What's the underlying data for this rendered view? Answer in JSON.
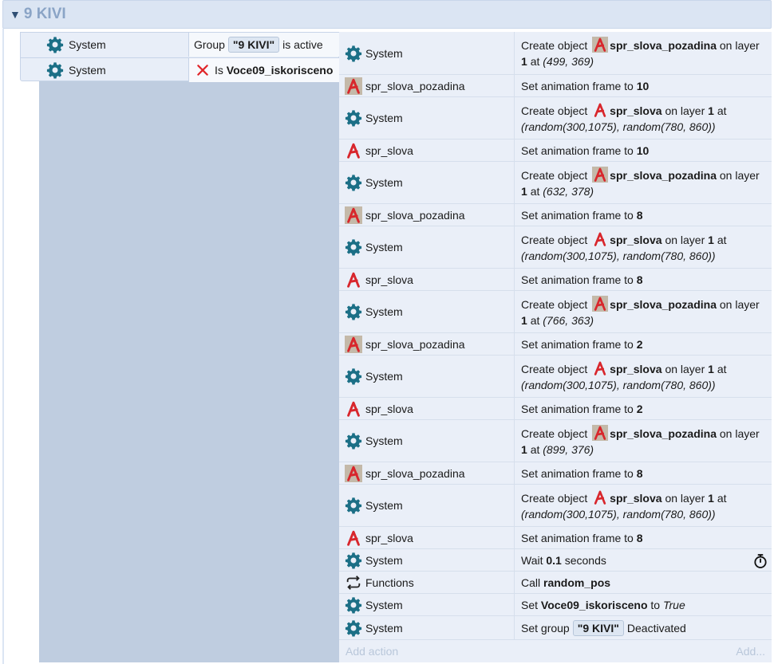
{
  "group": {
    "title": "9 KIVI",
    "collapse_icon": "triangle-down-icon"
  },
  "conditions": [
    {
      "object": "System",
      "icon": "gear-icon",
      "text_before": "Group",
      "chip": "\"9 KIVI\"",
      "text_after": "is active"
    },
    {
      "object": "System",
      "icon": "gear-icon",
      "inverted_icon": "red-x-icon",
      "text_before": "Is",
      "bold": "Voce09_iskorisceno"
    }
  ],
  "actions": [
    {
      "object": "System",
      "icon": "gear-icon",
      "line1_pre": "Create object",
      "line1_obj": "spr_slova_pozadina",
      "line1_post": "on layer",
      "layer": "1",
      "at": "at",
      "coords": "(499, 369)"
    },
    {
      "object": "spr_slova_pozadina",
      "icon": "sprite-a-bg-icon",
      "text": "Set animation frame to",
      "value": "10"
    },
    {
      "object": "System",
      "icon": "gear-icon",
      "line1_pre": "Create object",
      "line1_obj": "spr_slova",
      "line1_post": "on layer",
      "layer": "1",
      "at": "at",
      "coords": "(random(300,1075), random(780, 860))"
    },
    {
      "object": "spr_slova",
      "icon": "sprite-a-icon",
      "text": "Set animation frame to",
      "value": "10"
    },
    {
      "object": "System",
      "icon": "gear-icon",
      "line1_pre": "Create object",
      "line1_obj": "spr_slova_pozadina",
      "line1_post": "on layer",
      "layer": "1",
      "at": "at",
      "coords": "(632, 378)"
    },
    {
      "object": "spr_slova_pozadina",
      "icon": "sprite-a-bg-icon",
      "text": "Set animation frame to",
      "value": "8"
    },
    {
      "object": "System",
      "icon": "gear-icon",
      "line1_pre": "Create object",
      "line1_obj": "spr_slova",
      "line1_post": "on layer",
      "layer": "1",
      "at": "at",
      "coords": "(random(300,1075), random(780, 860))"
    },
    {
      "object": "spr_slova",
      "icon": "sprite-a-icon",
      "text": "Set animation frame to",
      "value": "8"
    },
    {
      "object": "System",
      "icon": "gear-icon",
      "line1_pre": "Create object",
      "line1_obj": "spr_slova_pozadina",
      "line1_post": "on layer",
      "layer": "1",
      "at": "at",
      "coords": "(766, 363)"
    },
    {
      "object": "spr_slova_pozadina",
      "icon": "sprite-a-bg-icon",
      "text": "Set animation frame to",
      "value": "2"
    },
    {
      "object": "System",
      "icon": "gear-icon",
      "line1_pre": "Create object",
      "line1_obj": "spr_slova",
      "line1_post": "on layer",
      "layer": "1",
      "at": "at",
      "coords": "(random(300,1075), random(780, 860))"
    },
    {
      "object": "spr_slova",
      "icon": "sprite-a-icon",
      "text": "Set animation frame to",
      "value": "2"
    },
    {
      "object": "System",
      "icon": "gear-icon",
      "line1_pre": "Create object",
      "line1_obj": "spr_slova_pozadina",
      "line1_post": "on layer",
      "layer": "1",
      "at": "at",
      "coords": "(899, 376)"
    },
    {
      "object": "spr_slova_pozadina",
      "icon": "sprite-a-bg-icon",
      "text": "Set animation frame to",
      "value": "8"
    },
    {
      "object": "System",
      "icon": "gear-icon",
      "line1_pre": "Create object",
      "line1_obj": "spr_slova",
      "line1_post": "on layer",
      "layer": "1",
      "at": "at",
      "coords": "(random(300,1075), random(780, 860))"
    },
    {
      "object": "spr_slova",
      "icon": "sprite-a-icon",
      "text": "Set animation frame to",
      "value": "8"
    },
    {
      "object": "System",
      "icon": "gear-icon",
      "wait_pre": "Wait",
      "wait_val": "0.1",
      "wait_post": "seconds",
      "extra_icon": "stopwatch-icon"
    },
    {
      "object": "Functions",
      "icon": "loop-arrows-icon",
      "call_pre": "Call",
      "call_val": "random_pos"
    },
    {
      "object": "System",
      "icon": "gear-icon",
      "set_pre": "Set",
      "set_var": "Voce09_iskorisceno",
      "set_to": "to",
      "set_val": "True"
    },
    {
      "object": "System",
      "icon": "gear-icon",
      "grp_pre": "Set group",
      "grp_chip": "\"9 KIVI\"",
      "grp_post": "Deactivated"
    }
  ],
  "add_action": {
    "left": "Add action",
    "right": "Add..."
  },
  "colors": {
    "header_bg": "#dbe5f3",
    "title": "#8aa4c6",
    "gear": "#1b6f86",
    "sprite_red": "#d8262c",
    "event_body": "#bfcde0",
    "actions_bg": "#eaeff8"
  }
}
